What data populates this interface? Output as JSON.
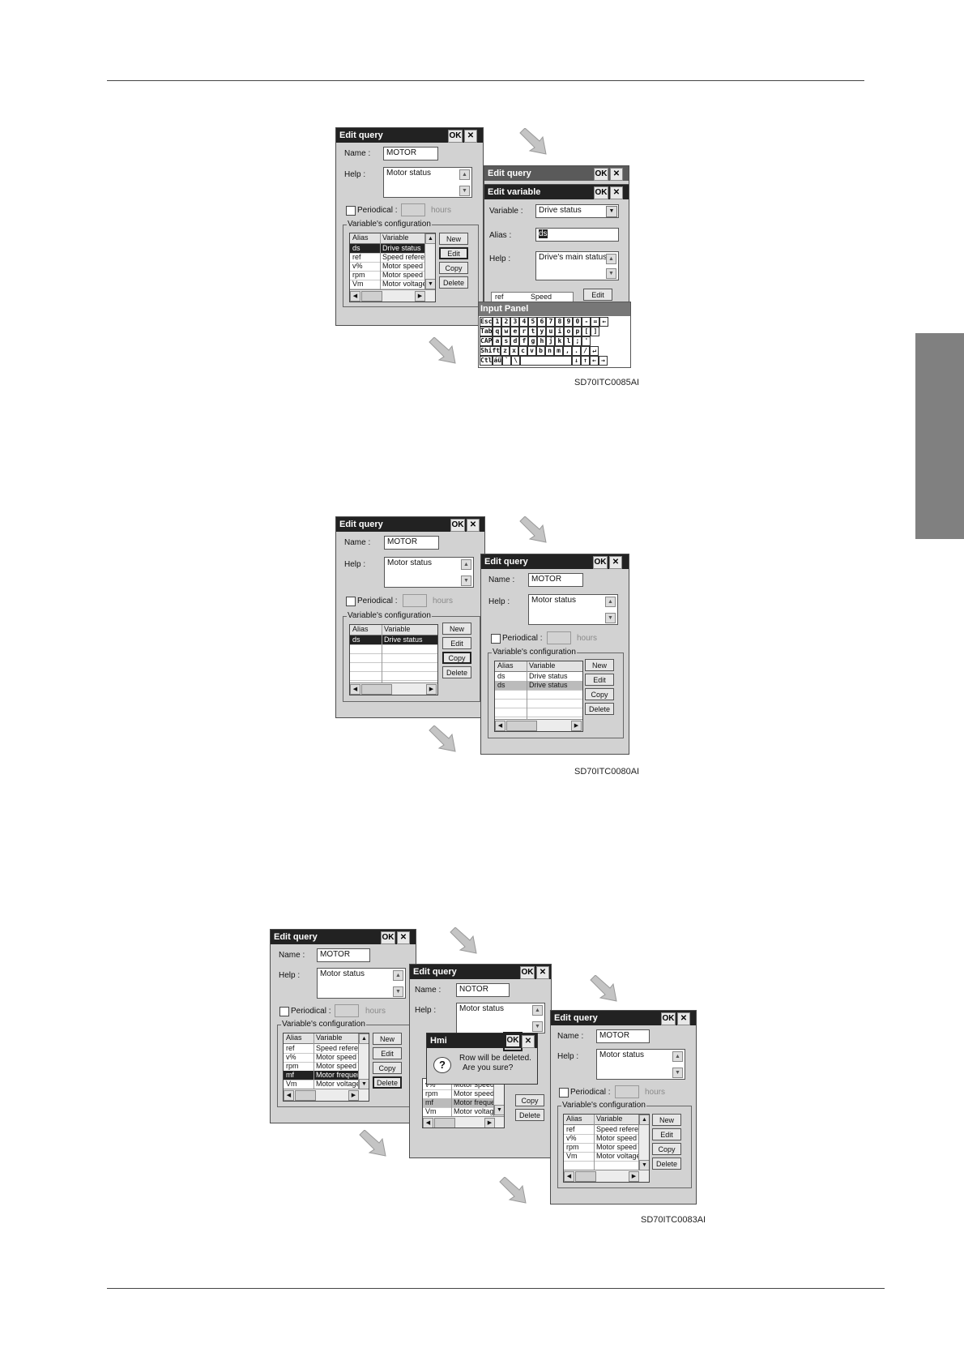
{
  "figures": [
    {
      "code": "SD70ITC0085AI",
      "query": {
        "title": "Edit query",
        "ok": "OK",
        "close": "✕",
        "name_label": "Name :",
        "name": "MOTOR",
        "help_label": "Help :",
        "help": "Motor status",
        "periodical": "Periodical :",
        "hours": "hours",
        "group": "Variable's configuration",
        "col_alias": "Alias",
        "col_variable": "Variable",
        "rows": [
          [
            "ds",
            "Drive status"
          ],
          [
            "ref",
            "Speed referen"
          ],
          [
            "v%",
            "Motor speed"
          ],
          [
            "rpm",
            "Motor speed"
          ],
          [
            "Vm",
            "Motor voltage"
          ]
        ],
        "buttons": [
          "New",
          "Edit",
          "Copy",
          "Delete"
        ]
      },
      "back_title": "Edit query",
      "variable": {
        "title": "Edit variable",
        "variable_label": "Variable :",
        "variable": "Drive status",
        "alias_label": "Alias :",
        "alias": "ds",
        "help_label": "Help :",
        "help": "Drive's main status",
        "partial_row": [
          "ref",
          "Speed referen"
        ],
        "partial_button": "Edit"
      },
      "keyboard": {
        "title": "Input Panel",
        "rows": [
          [
            "Esc",
            "1",
            "2",
            "3",
            "4",
            "5",
            "6",
            "7",
            "8",
            "9",
            "0",
            "-",
            "=",
            "←"
          ],
          [
            "Tab",
            "q",
            "w",
            "e",
            "r",
            "t",
            "y",
            "u",
            "i",
            "o",
            "p",
            "[",
            "]"
          ],
          [
            "CAP",
            "a",
            "s",
            "d",
            "f",
            "g",
            "h",
            "j",
            "k",
            "l",
            ";",
            "'"
          ],
          [
            "Shift",
            "z",
            "x",
            "c",
            "v",
            "b",
            "n",
            "m",
            ",",
            ".",
            "/",
            "↵"
          ],
          [
            "Ctl",
            "áü",
            "`",
            "\\",
            "",
            "↓",
            "↑",
            "←",
            "→"
          ]
        ]
      }
    },
    {
      "code": "SD70ITC0080AI",
      "before": {
        "title": "Edit query",
        "ok": "OK",
        "close": "✕",
        "name_label": "Name :",
        "name": "MOTOR",
        "help_label": "Help :",
        "help": "Motor status",
        "periodical": "Periodical :",
        "hours": "hours",
        "group": "Variable's configuration",
        "col_alias": "Alias",
        "col_variable": "Variable",
        "rows": [
          [
            "ds",
            "Drive status"
          ]
        ],
        "buttons": [
          "New",
          "Edit",
          "Copy",
          "Delete"
        ]
      },
      "after": {
        "title": "Edit query",
        "ok": "OK",
        "close": "✕",
        "name_label": "Name :",
        "name": "MOTOR",
        "help_label": "Help :",
        "help": "Motor status",
        "periodical": "Periodical :",
        "hours": "hours",
        "group": "Variable's configuration",
        "col_alias": "Alias",
        "col_variable": "Variable",
        "rows": [
          [
            "ds",
            "Drive status"
          ],
          [
            "ds",
            "Drive status"
          ]
        ],
        "buttons": [
          "New",
          "Edit",
          "Copy",
          "Delete"
        ]
      }
    },
    {
      "code": "SD70ITC0083AI",
      "before": {
        "title": "Edit query",
        "ok": "OK",
        "close": "✕",
        "name_label": "Name :",
        "name": "MOTOR",
        "help_label": "Help :",
        "help": "Motor status",
        "periodical": "Periodical :",
        "hours": "hours",
        "group": "Variable's configuration",
        "col_alias": "Alias",
        "col_variable": "Variable",
        "rows": [
          [
            "ref",
            "Speed referen"
          ],
          [
            "v%",
            "Motor speed"
          ],
          [
            "rpm",
            "Motor speed"
          ],
          [
            "mf",
            "Motor frequen"
          ],
          [
            "Vm",
            "Motor voltage"
          ]
        ],
        "buttons": [
          "New",
          "Edit",
          "Copy",
          "Delete"
        ]
      },
      "middle": {
        "title": "Edit query",
        "ok": "OK",
        "close": "✕",
        "name_label": "Name :",
        "name": "NOTOR",
        "help_label": "Help :",
        "help": "Motor status",
        "rows": [
          [
            "v%",
            "Motor speed"
          ],
          [
            "rpm",
            "Motor speed"
          ],
          [
            "mf",
            "Motor frequen"
          ],
          [
            "Vm",
            "Motor voltage"
          ]
        ],
        "buttons": [
          "Copy",
          "Delete"
        ],
        "msg": {
          "title": "Hmi",
          "ok": "OK",
          "close": "✕",
          "line1": "Row will be deleted.",
          "line2": "Are you sure?"
        }
      },
      "after": {
        "title": "Edit query",
        "ok": "OK",
        "close": "✕",
        "name_label": "Name :",
        "name": "MOTOR",
        "help_label": "Help :",
        "help": "Motor status",
        "periodical": "Periodical :",
        "hours": "hours",
        "group": "Variable's configuration",
        "col_alias": "Alias",
        "col_variable": "Variable",
        "rows": [
          [
            "ref",
            "Speed referen"
          ],
          [
            "v%",
            "Motor speed"
          ],
          [
            "rpm",
            "Motor speed"
          ],
          [
            "Vm",
            "Motor voltage"
          ]
        ],
        "buttons": [
          "New",
          "Edit",
          "Copy",
          "Delete"
        ]
      }
    }
  ]
}
